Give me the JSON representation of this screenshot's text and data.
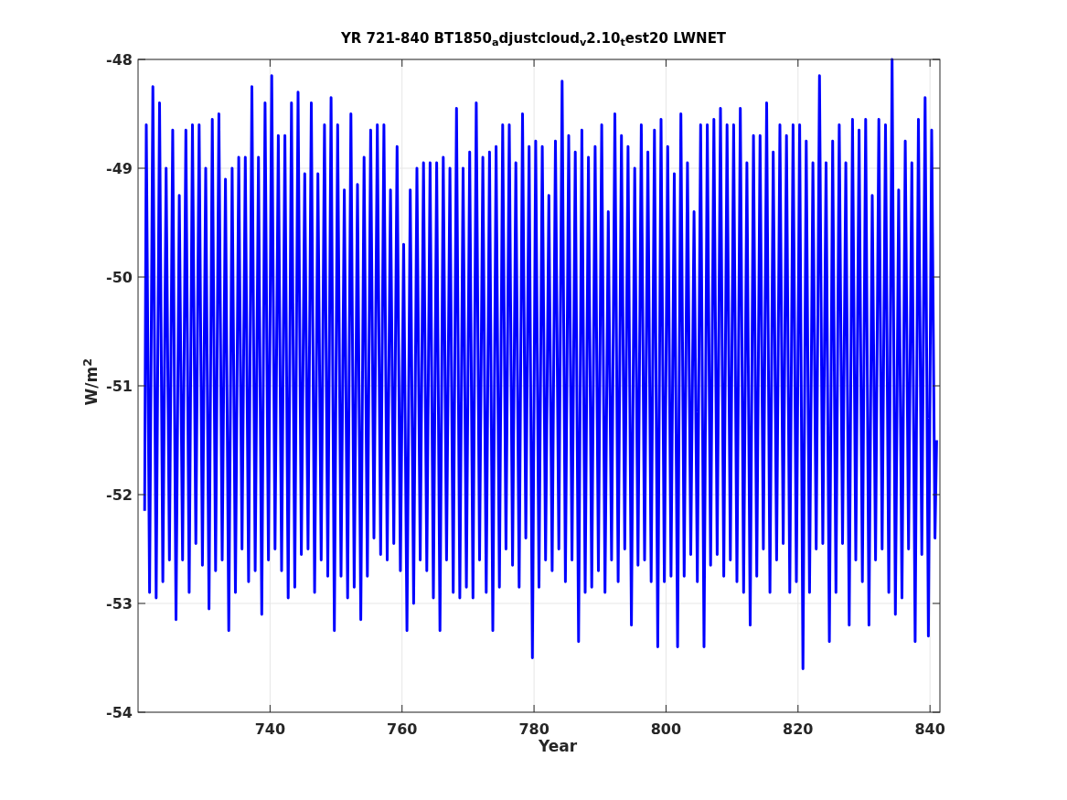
{
  "figure": {
    "chart_data": {
      "type": "line",
      "title": "YR 721-840 BT1850$_{a}$djustcloud$_{v}$2.10$_{t}$est20 LWNET",
      "xlabel": "Year",
      "ylabel": "W/m$^{2}$",
      "xlim": [
        720,
        841.5
      ],
      "ylim": [
        -54,
        -48
      ],
      "grid": true,
      "xticks": [
        740,
        760,
        780,
        800,
        820,
        840
      ],
      "yticks": [
        -54,
        -53,
        -52,
        -51,
        -50,
        -49,
        -48
      ],
      "x": [
        721,
        721.25,
        721.75,
        722.25,
        722.75,
        723.25,
        723.75,
        724.25,
        724.75,
        725.25,
        725.75,
        726.25,
        726.75,
        727.25,
        727.75,
        728.25,
        728.75,
        729.25,
        729.75,
        730.25,
        730.75,
        731.25,
        731.75,
        732.25,
        732.75,
        733.25,
        733.75,
        734.25,
        734.75,
        735.25,
        735.75,
        736.25,
        736.75,
        737.25,
        737.75,
        738.25,
        738.75,
        739.25,
        739.75,
        740.25,
        740.75,
        741.25,
        741.75,
        742.25,
        742.75,
        743.25,
        743.75,
        744.25,
        744.75,
        745.25,
        745.75,
        746.25,
        746.75,
        747.25,
        747.75,
        748.25,
        748.75,
        749.25,
        749.75,
        750.25,
        750.75,
        751.25,
        751.75,
        752.25,
        752.75,
        753.25,
        753.75,
        754.25,
        754.75,
        755.25,
        755.75,
        756.25,
        756.75,
        757.25,
        757.75,
        758.25,
        758.75,
        759.25,
        759.75,
        760.25,
        760.75,
        761.25,
        761.75,
        762.25,
        762.75,
        763.25,
        763.75,
        764.25,
        764.75,
        765.25,
        765.75,
        766.25,
        766.75,
        767.25,
        767.75,
        768.25,
        768.75,
        769.25,
        769.75,
        770.25,
        770.75,
        771.25,
        771.75,
        772.25,
        772.75,
        773.25,
        773.75,
        774.25,
        774.75,
        775.25,
        775.75,
        776.25,
        776.75,
        777.25,
        777.75,
        778.25,
        778.75,
        779.25,
        779.75,
        780.25,
        780.75,
        781.25,
        781.75,
        782.25,
        782.75,
        783.25,
        783.75,
        784.25,
        784.75,
        785.25,
        785.75,
        786.25,
        786.75,
        787.25,
        787.75,
        788.25,
        788.75,
        789.25,
        789.75,
        790.25,
        790.75,
        791.25,
        791.75,
        792.25,
        792.75,
        793.25,
        793.75,
        794.25,
        794.75,
        795.25,
        795.75,
        796.25,
        796.75,
        797.25,
        797.75,
        798.25,
        798.75,
        799.25,
        799.75,
        800.25,
        800.75,
        801.25,
        801.75,
        802.25,
        802.75,
        803.25,
        803.75,
        804.25,
        804.75,
        805.25,
        805.75,
        806.25,
        806.75,
        807.25,
        807.75,
        808.25,
        808.75,
        809.25,
        809.75,
        810.25,
        810.75,
        811.25,
        811.75,
        812.25,
        812.75,
        813.25,
        813.75,
        814.25,
        814.75,
        815.25,
        815.75,
        816.25,
        816.75,
        817.25,
        817.75,
        818.25,
        818.75,
        819.25,
        819.75,
        820.25,
        820.75,
        821.25,
        821.75,
        822.25,
        822.75,
        823.25,
        823.75,
        824.25,
        824.75,
        825.25,
        825.75,
        826.25,
        826.75,
        827.25,
        827.75,
        828.25,
        828.75,
        829.25,
        829.75,
        830.25,
        830.75,
        831.25,
        831.75,
        832.25,
        832.75,
        833.25,
        833.75,
        834.25,
        834.75,
        835.25,
        835.75,
        836.25,
        836.75,
        837.25,
        837.75,
        838.25,
        838.75,
        839.25,
        839.75,
        840.25,
        840.75,
        841
      ],
      "series": [
        {
          "color": "#0000ff",
          "values": [
            -52.15,
            -48.6,
            -52.9,
            -48.25,
            -52.95,
            -48.4,
            -52.8,
            -49.0,
            -52.6,
            -48.65,
            -53.15,
            -49.25,
            -52.6,
            -48.65,
            -52.9,
            -48.6,
            -52.45,
            -48.6,
            -52.65,
            -49.0,
            -53.05,
            -48.55,
            -52.7,
            -48.5,
            -52.6,
            -49.1,
            -53.25,
            -49.0,
            -52.9,
            -48.9,
            -52.5,
            -48.9,
            -52.8,
            -48.25,
            -52.7,
            -48.9,
            -53.1,
            -48.4,
            -52.6,
            -48.15,
            -52.5,
            -48.7,
            -52.7,
            -48.7,
            -52.95,
            -48.4,
            -52.85,
            -48.3,
            -52.55,
            -49.05,
            -52.5,
            -48.4,
            -52.9,
            -49.05,
            -52.6,
            -48.6,
            -52.75,
            -48.35,
            -53.25,
            -48.6,
            -52.75,
            -49.2,
            -52.95,
            -48.5,
            -52.85,
            -49.15,
            -53.15,
            -48.9,
            -52.75,
            -48.65,
            -52.4,
            -48.6,
            -52.55,
            -48.6,
            -52.6,
            -49.2,
            -52.45,
            -48.8,
            -52.7,
            -49.7,
            -53.25,
            -49.2,
            -53.0,
            -49.0,
            -52.6,
            -48.95,
            -52.7,
            -48.95,
            -52.95,
            -48.95,
            -53.25,
            -48.9,
            -52.6,
            -49.0,
            -52.9,
            -48.45,
            -52.95,
            -49.0,
            -52.85,
            -48.85,
            -52.95,
            -48.4,
            -52.6,
            -48.9,
            -52.9,
            -48.85,
            -53.25,
            -48.8,
            -52.85,
            -48.6,
            -52.5,
            -48.6,
            -52.65,
            -48.95,
            -52.85,
            -48.5,
            -52.4,
            -48.8,
            -53.5,
            -48.75,
            -52.85,
            -48.8,
            -52.6,
            -49.25,
            -52.7,
            -48.75,
            -52.5,
            -48.2,
            -52.8,
            -48.7,
            -52.6,
            -48.85,
            -53.35,
            -48.65,
            -52.9,
            -48.9,
            -52.85,
            -48.8,
            -52.7,
            -48.6,
            -52.9,
            -49.4,
            -52.6,
            -48.5,
            -52.8,
            -48.7,
            -52.5,
            -48.8,
            -53.2,
            -49.0,
            -52.65,
            -48.6,
            -52.6,
            -48.85,
            -52.8,
            -48.65,
            -53.4,
            -48.55,
            -52.8,
            -48.8,
            -52.75,
            -49.05,
            -53.4,
            -48.5,
            -52.75,
            -48.95,
            -52.55,
            -49.4,
            -52.8,
            -48.6,
            -53.4,
            -48.6,
            -52.65,
            -48.55,
            -52.55,
            -48.45,
            -52.75,
            -48.6,
            -52.6,
            -48.6,
            -52.8,
            -48.45,
            -52.9,
            -48.95,
            -53.2,
            -48.7,
            -52.75,
            -48.7,
            -52.5,
            -48.4,
            -52.9,
            -48.85,
            -52.6,
            -48.6,
            -52.45,
            -48.7,
            -52.9,
            -48.6,
            -52.8,
            -48.6,
            -53.6,
            -48.75,
            -52.9,
            -48.95,
            -52.5,
            -48.15,
            -52.45,
            -48.95,
            -53.35,
            -48.75,
            -52.9,
            -48.6,
            -52.45,
            -48.95,
            -53.2,
            -48.55,
            -52.6,
            -48.65,
            -52.8,
            -48.55,
            -53.2,
            -49.25,
            -52.6,
            -48.55,
            -52.5,
            -48.6,
            -52.9,
            -48.0,
            -53.1,
            -49.2,
            -52.95,
            -48.75,
            -52.5,
            -48.95,
            -53.35,
            -48.55,
            -52.55,
            -48.35,
            -53.3,
            -48.65,
            -52.4,
            -51.5
          ]
        }
      ]
    }
  }
}
